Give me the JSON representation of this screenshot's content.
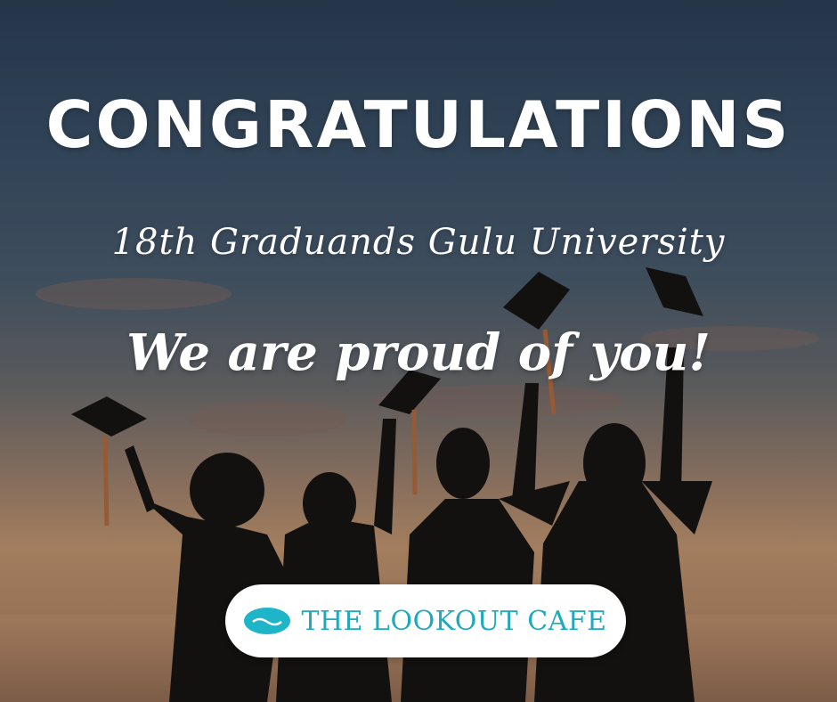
{
  "headline": "CONGRATULATIONS",
  "subheadline": "18th Graduands Gulu University",
  "message": "We are proud of you!",
  "brand": {
    "name": "THE LOOKOUT CAFE",
    "logo_icon": "wave-logo-icon",
    "accent_color": "#1fb5c9"
  },
  "colors": {
    "text": "#ffffff",
    "sky_top": "#2b3d52",
    "sky_horizon": "#c4956c",
    "silhouette": "#15100d"
  }
}
